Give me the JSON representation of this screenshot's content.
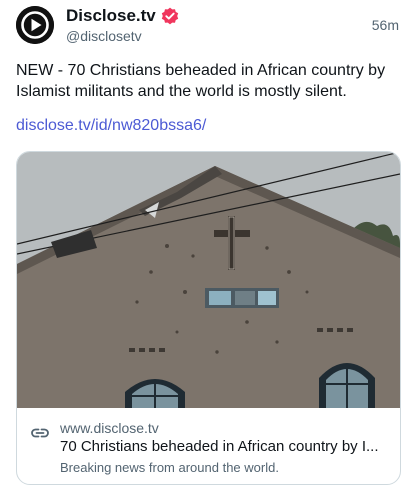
{
  "author": {
    "display_name": "Disclose.tv",
    "handle": "@disclosetv",
    "verified": true,
    "avatar_icon": "play-logo-icon",
    "badge_color": "#f0365d"
  },
  "post": {
    "timestamp": "56m",
    "text": "NEW - 70 Christians beheaded in African country by Islamist militants and the world is mostly silent.",
    "link": "disclose.tv/id/nw820bssa6/",
    "link_color": "#4c5ad4"
  },
  "link_card": {
    "image_alt": "Damaged church facade with a cross and bullet marks under an overcast sky",
    "icon": "link-icon",
    "domain": "www.disclose.tv",
    "title": "70 Christians beheaded in African country by I...",
    "description": "Breaking news from around the world."
  }
}
